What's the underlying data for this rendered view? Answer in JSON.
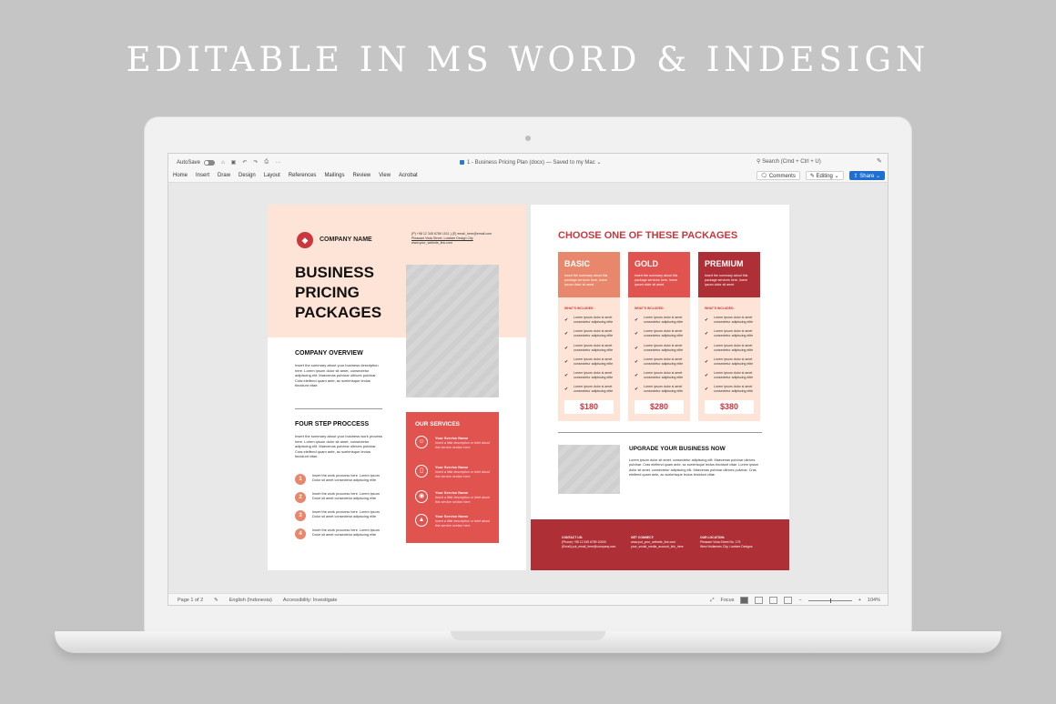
{
  "headline": "EDITABLE IN MS WORD & INDESIGN",
  "app": {
    "autosave_label": "AutoSave",
    "quick_access": [
      "⌂",
      "▣",
      "↶",
      "↷",
      "⎙",
      "···"
    ],
    "doc_title": "1 - Business Pricing Plan (docx) — Saved to my Mac ⌄",
    "search_placeholder": "Search (Cmd + Ctrl + U)",
    "tabs": [
      "Home",
      "Insert",
      "Draw",
      "Design",
      "Layout",
      "References",
      "Mailings",
      "Review",
      "View",
      "Acrobat"
    ],
    "comments_label": "Comments",
    "editing_label": "Editing ⌄",
    "share_label": "Share ⌄",
    "status": {
      "page": "Page 1 of 2",
      "language": "English (Indonesia)",
      "accessibility": "Accessibility: Investigate",
      "focus": "Focus",
      "zoom": "104%"
    }
  },
  "left_page": {
    "company_name": "COMPANY NAME",
    "contact_lines": [
      "(P) +98 12 345 6789 1011 | (E) email_here@email.com",
      "Pleasant Vista Street, Lowfare Design City",
      "www.your_website_link.com"
    ],
    "title_lines": [
      "BUSINESS",
      "PRICING",
      "PACKAGES"
    ],
    "overview_heading": "COMPANY OVERVIEW",
    "overview_text": "Insert the summary about your business description here. Lorem ipsum dolor sit amet, consectetur adipiscing elit. Maecenas pulvinar ultrices pulvinar. Cras eleifend quam ante, ac scelerisque lectus tincidunt vitae.",
    "steps_heading": "FOUR STEP PROCCESS",
    "steps_text": "Insert the summary about your business work process here. Lorem ipsum dolor sit amet, consectetur adipiscing elit. Maecenas pulvinar ultrices pulvinar. Cras eleifend quam ante, ac scelerisque lectus tincidunt vitae.",
    "steps": [
      {
        "num": "1",
        "text": "Insert the work proccess here. Lorem ipsum Dolor sit amet consectetur adipiscing elite"
      },
      {
        "num": "2",
        "text": "Insert the work proccess here. Lorem ipsum Dolor sit amet consectetur adipiscing elite"
      },
      {
        "num": "3",
        "text": "Insert the work proccess here. Lorem ipsum Dolor sit amet consectetur adipiscing elite"
      },
      {
        "num": "4",
        "text": "Insert the work proccess here. Lorem ipsum Dolor sit amet consectetur adipiscing elite"
      }
    ],
    "services_heading": "OUR SERVICES",
    "services": [
      {
        "icon": "user-icon",
        "glyph": "☺",
        "name": "Your Service Name",
        "desc": "Insert a little description or brief about this service section here"
      },
      {
        "icon": "phone-icon",
        "glyph": "▯",
        "name": "Your Service Name",
        "desc": "Insert a little description or brief about this service section here"
      },
      {
        "icon": "lightbulb-icon",
        "glyph": "◉",
        "name": "Your Service Name",
        "desc": "Insert a little description or brief about this service section here"
      },
      {
        "icon": "rocket-icon",
        "glyph": "▲",
        "name": "Your Service Name",
        "desc": "Insert a little description or brief about this service section here"
      }
    ]
  },
  "right_page": {
    "title": "CHOOSE ONE OF THESE PACKAGES",
    "included_label": "WHAT'S INCLUDED:",
    "packages": [
      {
        "name": "BASIC",
        "color": "#e8876b",
        "desc": "Insert the summary about this package services here, lorem ipsum dolor sit amet.",
        "price": "$180"
      },
      {
        "name": "GOLD",
        "color": "#e0534f",
        "desc": "Insert the summary about this package services here, lorem ipsum dolor sit amet.",
        "price": "$280"
      },
      {
        "name": "PREMIUM",
        "color": "#ae2f35",
        "desc": "Insert the summary about this package services here, lorem ipsum dolor sit amet.",
        "price": "$380"
      }
    ],
    "item_text": "Lorem ipsum dolor si amet consectetur adipiscing elite",
    "upgrade_heading": "UPGRADE YOUR BUSINESS NOW",
    "upgrade_text": "Lorem ipsum dolor sit amet, consectetur adipiscing elit. Maecenas pulvinar ultrices pulvinar. Cras eleifend quam ante, ac scelerisque lectus tincidunt vitae. Lorem ipsum dolor sit amet, consectetur adipiscing elit. Maecenas pulvinar ultrices pulvinar. Cras eleifend quam ante, ac scelerisque lectus tincidunt vitae.",
    "footer": [
      {
        "heading": "CONTACT US:",
        "lines": [
          "(Phone) +98 12 345 6789 10000",
          "(Email) put_email_here@company.com"
        ]
      },
      {
        "heading": "GET CONNECT:",
        "lines": [
          "www.put_your_website_link.com",
          "your_social_media_account_link_here"
        ]
      },
      {
        "heading": "OUR LOCATION:",
        "lines": [
          "Pleasant Vista Street No. 175",
          "West Hollarmes City, Lowfare Designs"
        ]
      }
    ]
  },
  "colors": {
    "accent": "#c8383d",
    "peach": "#fde4d6",
    "coral": "#e0534f",
    "dark_red": "#ae2f35"
  }
}
